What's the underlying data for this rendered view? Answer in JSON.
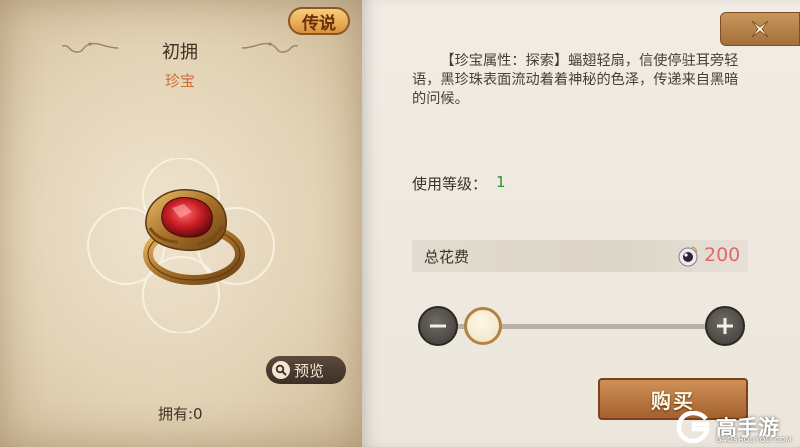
{
  "item": {
    "rarity": "传说",
    "name": "初拥",
    "type": "珍宝",
    "preview_label": "预览",
    "owned_label": "拥有:0"
  },
  "detail": {
    "description": "【珍宝属性：探索】蝠翅轻扇，信使停驻耳旁轻语，黑珍珠表面流动着着神秘的色泽，传递来自黑暗的问候。",
    "level_label": "使用等级：",
    "level_value": "1",
    "cost_label": "总花费",
    "cost_value": "200",
    "cost_icon": "pearl-currency-icon",
    "quantity_slider": {
      "level": 0.15
    },
    "buy_label": "购买"
  },
  "watermark": {
    "text": "高手游",
    "sub": "GAOSHOUYOU.COM"
  },
  "colors": {
    "rarity_badge": "#e3a24a",
    "item_type": "#cf6b34",
    "level_value": "#3c8b2b",
    "cost_value": "#e06a6a",
    "buy_button": "#b8743e"
  }
}
